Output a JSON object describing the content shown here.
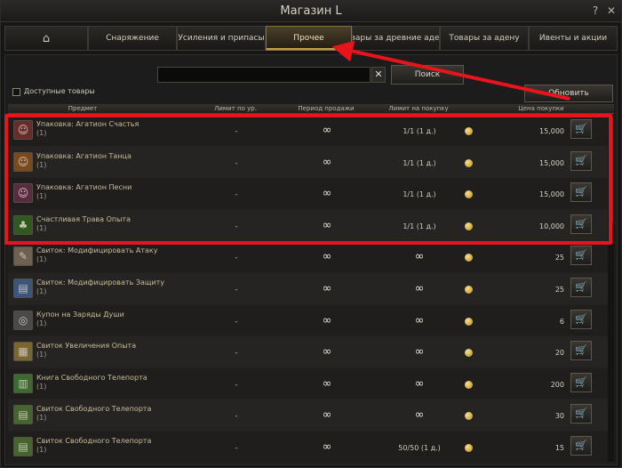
{
  "window": {
    "title": "Магазин L",
    "help_glyph": "?",
    "close_glyph": "✕"
  },
  "tabs": [
    {
      "label": "",
      "icon": "home-icon"
    },
    {
      "label": "Снаряжение"
    },
    {
      "label": "Усиления и припасы"
    },
    {
      "label": "Прочее",
      "active": true
    },
    {
      "label": "Товары за древние адены"
    },
    {
      "label": "Товары за адену"
    },
    {
      "label": "Ивенты и акции"
    }
  ],
  "search": {
    "placeholder": "",
    "value": "",
    "clear_glyph": "✕",
    "button_label": "Поиск"
  },
  "filter": {
    "available_only_label": "Доступные товары",
    "checked": false
  },
  "refresh_button_label": "Обновить",
  "columns": [
    "Предмет",
    "Лимит по ур.",
    "Период продажи",
    "Лимит на покупку",
    "Цена покупки"
  ],
  "items": [
    {
      "name": "Упаковка: Агатион Счастья",
      "qty": "(1)",
      "level_limit": "-",
      "period": "∞",
      "purchase_limit": "1/1 (1 д.)",
      "price": "15,000",
      "icon": "agathion-happiness-icon"
    },
    {
      "name": "Упаковка: Агатион Танца",
      "qty": "(1)",
      "level_limit": "-",
      "period": "∞",
      "purchase_limit": "1/1 (1 д.)",
      "price": "15,000",
      "icon": "agathion-dance-icon"
    },
    {
      "name": "Упаковка: Агатион Песни",
      "qty": "(1)",
      "level_limit": "-",
      "period": "∞",
      "purchase_limit": "1/1 (1 д.)",
      "price": "15,000",
      "icon": "agathion-song-icon"
    },
    {
      "name": "Счастливая Трава Опыта",
      "qty": "(1)",
      "level_limit": "-",
      "period": "∞",
      "purchase_limit": "1/1 (1 д.)",
      "price": "10,000",
      "icon": "clover-icon"
    },
    {
      "name": "Свиток: Модифицировать Атаку",
      "qty": "(1)",
      "level_limit": "-",
      "period": "∞",
      "purchase_limit": "∞",
      "price": "25",
      "icon": "scroll-attack-icon"
    },
    {
      "name": "Свиток: Модифицировать Защиту",
      "qty": "(1)",
      "level_limit": "-",
      "period": "∞",
      "purchase_limit": "∞",
      "price": "25",
      "icon": "scroll-defense-icon"
    },
    {
      "name": "Купон на Заряды Души",
      "qty": "(1)",
      "level_limit": "-",
      "period": "∞",
      "purchase_limit": "∞",
      "price": "6",
      "icon": "soul-coupon-icon"
    },
    {
      "name": "Свиток Увеличения Опыта",
      "qty": "(1)",
      "level_limit": "-",
      "period": "∞",
      "purchase_limit": "∞",
      "price": "20",
      "icon": "exp-scroll-icon"
    },
    {
      "name": "Книга Свободного Телепорта",
      "qty": "(1)",
      "level_limit": "-",
      "period": "∞",
      "purchase_limit": "∞",
      "price": "200",
      "icon": "teleport-book-icon"
    },
    {
      "name": "Свиток Свободного Телепорта",
      "qty": "(1)",
      "level_limit": "-",
      "period": "∞",
      "purchase_limit": "∞",
      "price": "30",
      "icon": "teleport-scroll-icon"
    },
    {
      "name": "Свиток Свободного Телепорта",
      "qty": "(1)",
      "level_limit": "-",
      "period": "∞",
      "purchase_limit": "50/50 (1 д.)",
      "price": "15",
      "icon": "teleport-scroll-icon"
    }
  ],
  "colors": {
    "highlight": "#e8141c",
    "accent": "#c99a4a",
    "coin": "#e3b847"
  }
}
